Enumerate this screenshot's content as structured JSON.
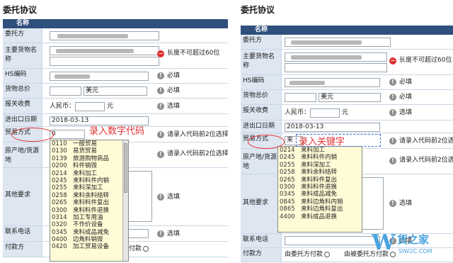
{
  "left": {
    "title": "委托协议",
    "header": "名称",
    "rows": {
      "consignor": "委托方",
      "goods_name": "主要货物名称",
      "goods_name_hint": "长度不可超过60位",
      "hs_code": "HS编码",
      "hs_code_hint": "必填",
      "total_price": "货物总价",
      "currency": "美元",
      "total_price_hint": "必填",
      "customs_fee": "报关收费",
      "rmb_label": "人民币：",
      "yuan": "元",
      "customs_fee_hint": "选填",
      "io_date": "进出口日期",
      "io_date_value": "2018-03-13",
      "trade_mode": "贸易方式",
      "trade_mode_value": "0",
      "trade_mode_hint": "请录入代码前2位选择",
      "origin": "原产地/货源地",
      "origin_hint": "请录入代码前2位选择",
      "other": "其他要求",
      "other_hint": "选填",
      "phone": "联系电话",
      "phone_hint": "选填",
      "payer": "付款方",
      "payer_option": "付款"
    },
    "annotation": "录入数字代码",
    "dropdown": [
      {
        "code": "0110",
        "name": "一般贸易"
      },
      {
        "code": "0130",
        "name": "易货贸易"
      },
      {
        "code": "0139",
        "name": "旅游购物商品"
      },
      {
        "code": "0200",
        "name": "料件销毁"
      },
      {
        "code": "0214",
        "name": "来料加工"
      },
      {
        "code": "0245",
        "name": "来料料件内销"
      },
      {
        "code": "0255",
        "name": "来料深加工"
      },
      {
        "code": "0258",
        "name": "来料余料结转"
      },
      {
        "code": "0265",
        "name": "来料料件复出"
      },
      {
        "code": "0300",
        "name": "来料料件退换"
      },
      {
        "code": "0314",
        "name": "加工专用油"
      },
      {
        "code": "0320",
        "name": "不作价设备"
      },
      {
        "code": "0345",
        "name": "来料成品减免"
      },
      {
        "code": "0400",
        "name": "边角料销毁"
      },
      {
        "code": "0420",
        "name": "加工贸易设备"
      }
    ]
  },
  "right": {
    "title": "委托协议",
    "header": "名称",
    "rows": {
      "consignor": "委托方",
      "goods_name": "主要货物名称",
      "goods_name_hint": "长度不可超过60位",
      "hs_code": "HS编码",
      "hs_code_hint": "必填",
      "total_price": "货物总价",
      "currency": "美元",
      "total_price_hint": "必填",
      "customs_fee": "报关收费",
      "rmb_label": "人民币：",
      "yuan": "元",
      "customs_fee_hint": "选填",
      "io_date": "进出口日期",
      "io_date_value": "2018-03-13",
      "trade_mode": "贸易方式",
      "trade_mode_value": "来",
      "trade_mode_hint": "请录入代码前2位选择",
      "origin": "原产地/货源地",
      "origin_hint": "请录入代码前2位选择",
      "other": "其他要求",
      "other_hint": "选填",
      "phone": "联系电话",
      "phone_hint": "选填",
      "payer": "付款方",
      "payer_option_1": "由委托方付款",
      "payer_option_2": "由被委托方付款"
    },
    "annotation": "录入关键字",
    "dropdown": [
      {
        "code": "0214",
        "name": "来料加工"
      },
      {
        "code": "0245",
        "name": "来料料件内销"
      },
      {
        "code": "0255",
        "name": "来料深加工"
      },
      {
        "code": "0258",
        "name": "来料余料结转"
      },
      {
        "code": "0265",
        "name": "来料料件复出"
      },
      {
        "code": "0300",
        "name": "来料料件退换"
      },
      {
        "code": "0345",
        "name": "来料成品减免"
      },
      {
        "code": "0845",
        "name": "来料边角料内销"
      },
      {
        "code": "0865",
        "name": "来料边角料复出"
      },
      {
        "code": "4400",
        "name": "来料成品退换"
      }
    ]
  },
  "watermark": {
    "logo": "W",
    "name": "货之家",
    "url": "SIW2C.COM"
  }
}
